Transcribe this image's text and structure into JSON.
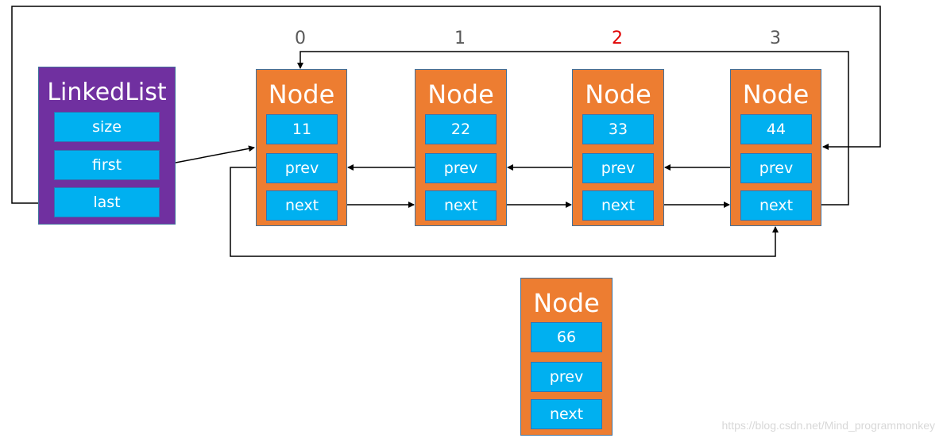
{
  "linked_list": {
    "title": "LinkedList",
    "fields": [
      "size",
      "first",
      "last"
    ]
  },
  "indices": [
    {
      "label": "0",
      "color": "#595959"
    },
    {
      "label": "1",
      "color": "#595959"
    },
    {
      "label": "2",
      "color": "#e00000"
    },
    {
      "label": "3",
      "color": "#595959"
    }
  ],
  "nodes": [
    {
      "title": "Node",
      "value": "11",
      "prev": "prev",
      "next": "next"
    },
    {
      "title": "Node",
      "value": "22",
      "prev": "prev",
      "next": "next"
    },
    {
      "title": "Node",
      "value": "33",
      "prev": "prev",
      "next": "next"
    },
    {
      "title": "Node",
      "value": "44",
      "prev": "prev",
      "next": "next"
    }
  ],
  "new_node": {
    "title": "Node",
    "value": "66",
    "prev": "prev",
    "next": "next"
  },
  "colors": {
    "linked_list": "#7030a0",
    "node": "#ed7d31",
    "field": "#00b0f0"
  },
  "watermark": "https://blog.csdn.net/Mind_programmonkey"
}
